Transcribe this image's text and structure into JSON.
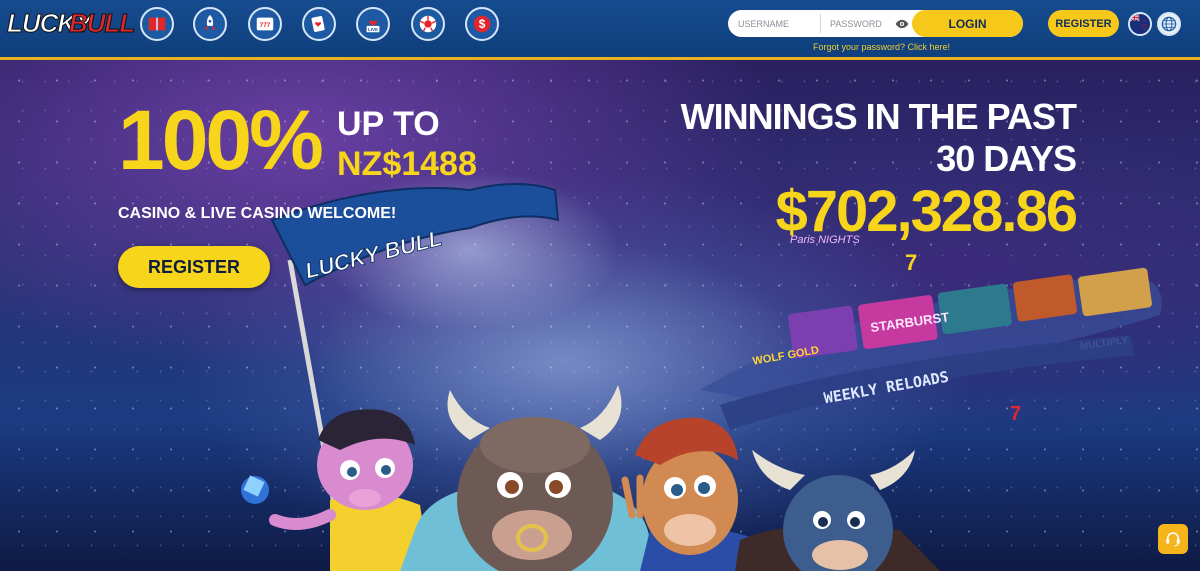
{
  "header": {
    "logo": {
      "part1": "LUCKY",
      "part2": "BULL"
    },
    "nav_icons": [
      "book-icon",
      "rocket-icon",
      "slot-machine-icon",
      "cards-icon",
      "live-icon",
      "soccer-ball-icon",
      "dollar-icon"
    ],
    "live_label": "LIVE",
    "login": {
      "username_placeholder": "USERNAME",
      "password_placeholder": "PASSWORD",
      "login_label": "LOGIN",
      "forgot_text": "Forgot your password? Click here!"
    },
    "register_label": "REGISTER"
  },
  "hero": {
    "percent": "100%",
    "up_to": "UP TO",
    "amount": "NZ$1488",
    "welcome": "CASINO & LIVE CASINO WELCOME!",
    "register_label": "REGISTER",
    "winnings_title": "WINNINGS IN THE PAST 30 DAYS",
    "winnings_amount": "$702,328.86",
    "flag_text": "LUCKY BULL",
    "carousel_labels": [
      "WEEKLY RELOADS",
      "STARBURST",
      "WOLF GOLD",
      "Paris NIGHTS",
      "MULTIPLY"
    ]
  },
  "colors": {
    "accent_yellow": "#f7d51a",
    "header_blue": "#164b8f",
    "logo_red": "#e3262b"
  }
}
